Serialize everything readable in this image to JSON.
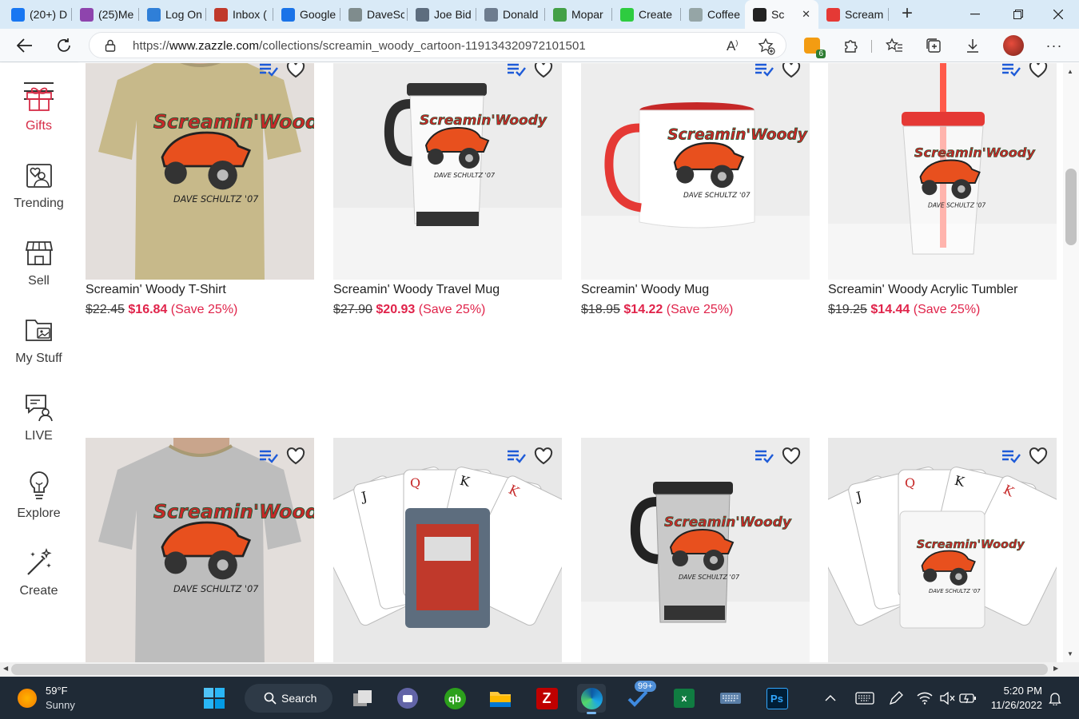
{
  "browser": {
    "tabs": [
      {
        "label": "(20+) D",
        "icon": "facebook-icon",
        "color": "#1877f2"
      },
      {
        "label": "(25)Me",
        "icon": "dots-icon",
        "color": "#8e44ad"
      },
      {
        "label": "Log On",
        "icon": "star-burst-icon",
        "color": "#2f7fd8"
      },
      {
        "label": "Inbox (",
        "icon": "calendar-14-icon",
        "color": "#c0392b"
      },
      {
        "label": "Google",
        "icon": "calendar-26-icon",
        "color": "#1a73e8"
      },
      {
        "label": "DaveSc",
        "icon": "profile-photo-icon",
        "color": "#7f8c8d"
      },
      {
        "label": "Joe Bid",
        "icon": "profile-photo-icon",
        "color": "#5d6d7e"
      },
      {
        "label": "Donald",
        "icon": "profile-photo-icon",
        "color": "#6d7c8e"
      },
      {
        "label": "Mopar",
        "icon": "leaf-icon",
        "color": "#43a047"
      },
      {
        "label": "Create",
        "icon": "thumbs-up-icon",
        "color": "#2ecc40"
      },
      {
        "label": "Coffee",
        "icon": "profile-photo-icon",
        "color": "#95a5a6"
      },
      {
        "label": "Sc",
        "icon": "zazzle-z-icon",
        "color": "#222222"
      },
      {
        "label": "Scream",
        "icon": "car-icon",
        "color": "#e53935"
      }
    ],
    "url_prefix": "https://",
    "url_domain": "www.zazzle.com",
    "url_path": "/collections/screamin_woody_cartoon-119134320972101501",
    "extension_badge": "6"
  },
  "sidebar": {
    "items": [
      {
        "label": "Gifts",
        "icon": "gift-icon",
        "active": true
      },
      {
        "label": "Trending",
        "icon": "trending-heart-icon"
      },
      {
        "label": "Sell",
        "icon": "store-icon"
      },
      {
        "label": "My Stuff",
        "icon": "folder-image-icon"
      },
      {
        "label": "LIVE",
        "icon": "live-chat-icon"
      },
      {
        "label": "Explore",
        "icon": "lightbulb-icon"
      },
      {
        "label": "Create",
        "icon": "magic-wand-icon"
      }
    ]
  },
  "products": [
    {
      "title": "Screamin' Woody T-Shirt",
      "old_price": "$22.45",
      "new_price": "$16.84",
      "save": "(Save 25%)",
      "image": "tan-tshirt-icon"
    },
    {
      "title": "Screamin' Woody Travel Mug",
      "old_price": "$27.90",
      "new_price": "$20.93",
      "save": "(Save 25%)",
      "image": "white-travel-mug-icon"
    },
    {
      "title": "Screamin' Woody Mug",
      "old_price": "$18.95",
      "new_price": "$14.22",
      "save": "(Save 25%)",
      "image": "red-handle-mug-icon"
    },
    {
      "title": "Screamin' Woody Acrylic Tumbler",
      "old_price": "$19.25",
      "new_price": "$14.44",
      "save": "(Save 25%)",
      "image": "acrylic-tumbler-icon"
    },
    {
      "title": "",
      "old_price": "",
      "new_price": "",
      "save": "",
      "image": "grey-tshirt-back-icon"
    },
    {
      "title": "",
      "old_price": "",
      "new_price": "",
      "save": "",
      "image": "playing-cards-photo-icon"
    },
    {
      "title": "",
      "old_price": "",
      "new_price": "",
      "save": "",
      "image": "steel-travel-mug-icon"
    },
    {
      "title": "",
      "old_price": "",
      "new_price": "",
      "save": "",
      "image": "playing-cards-logo-icon"
    }
  ],
  "taskbar": {
    "weather_temp": "59°F",
    "weather_desc": "Sunny",
    "search_label": "Search",
    "badge": "99+",
    "time": "5:20 PM",
    "date": "11/26/2022"
  },
  "colors": {
    "accent_red": "#e0234a",
    "tab_bar": "#d9eaf7",
    "taskbar": "#1f2a36"
  }
}
